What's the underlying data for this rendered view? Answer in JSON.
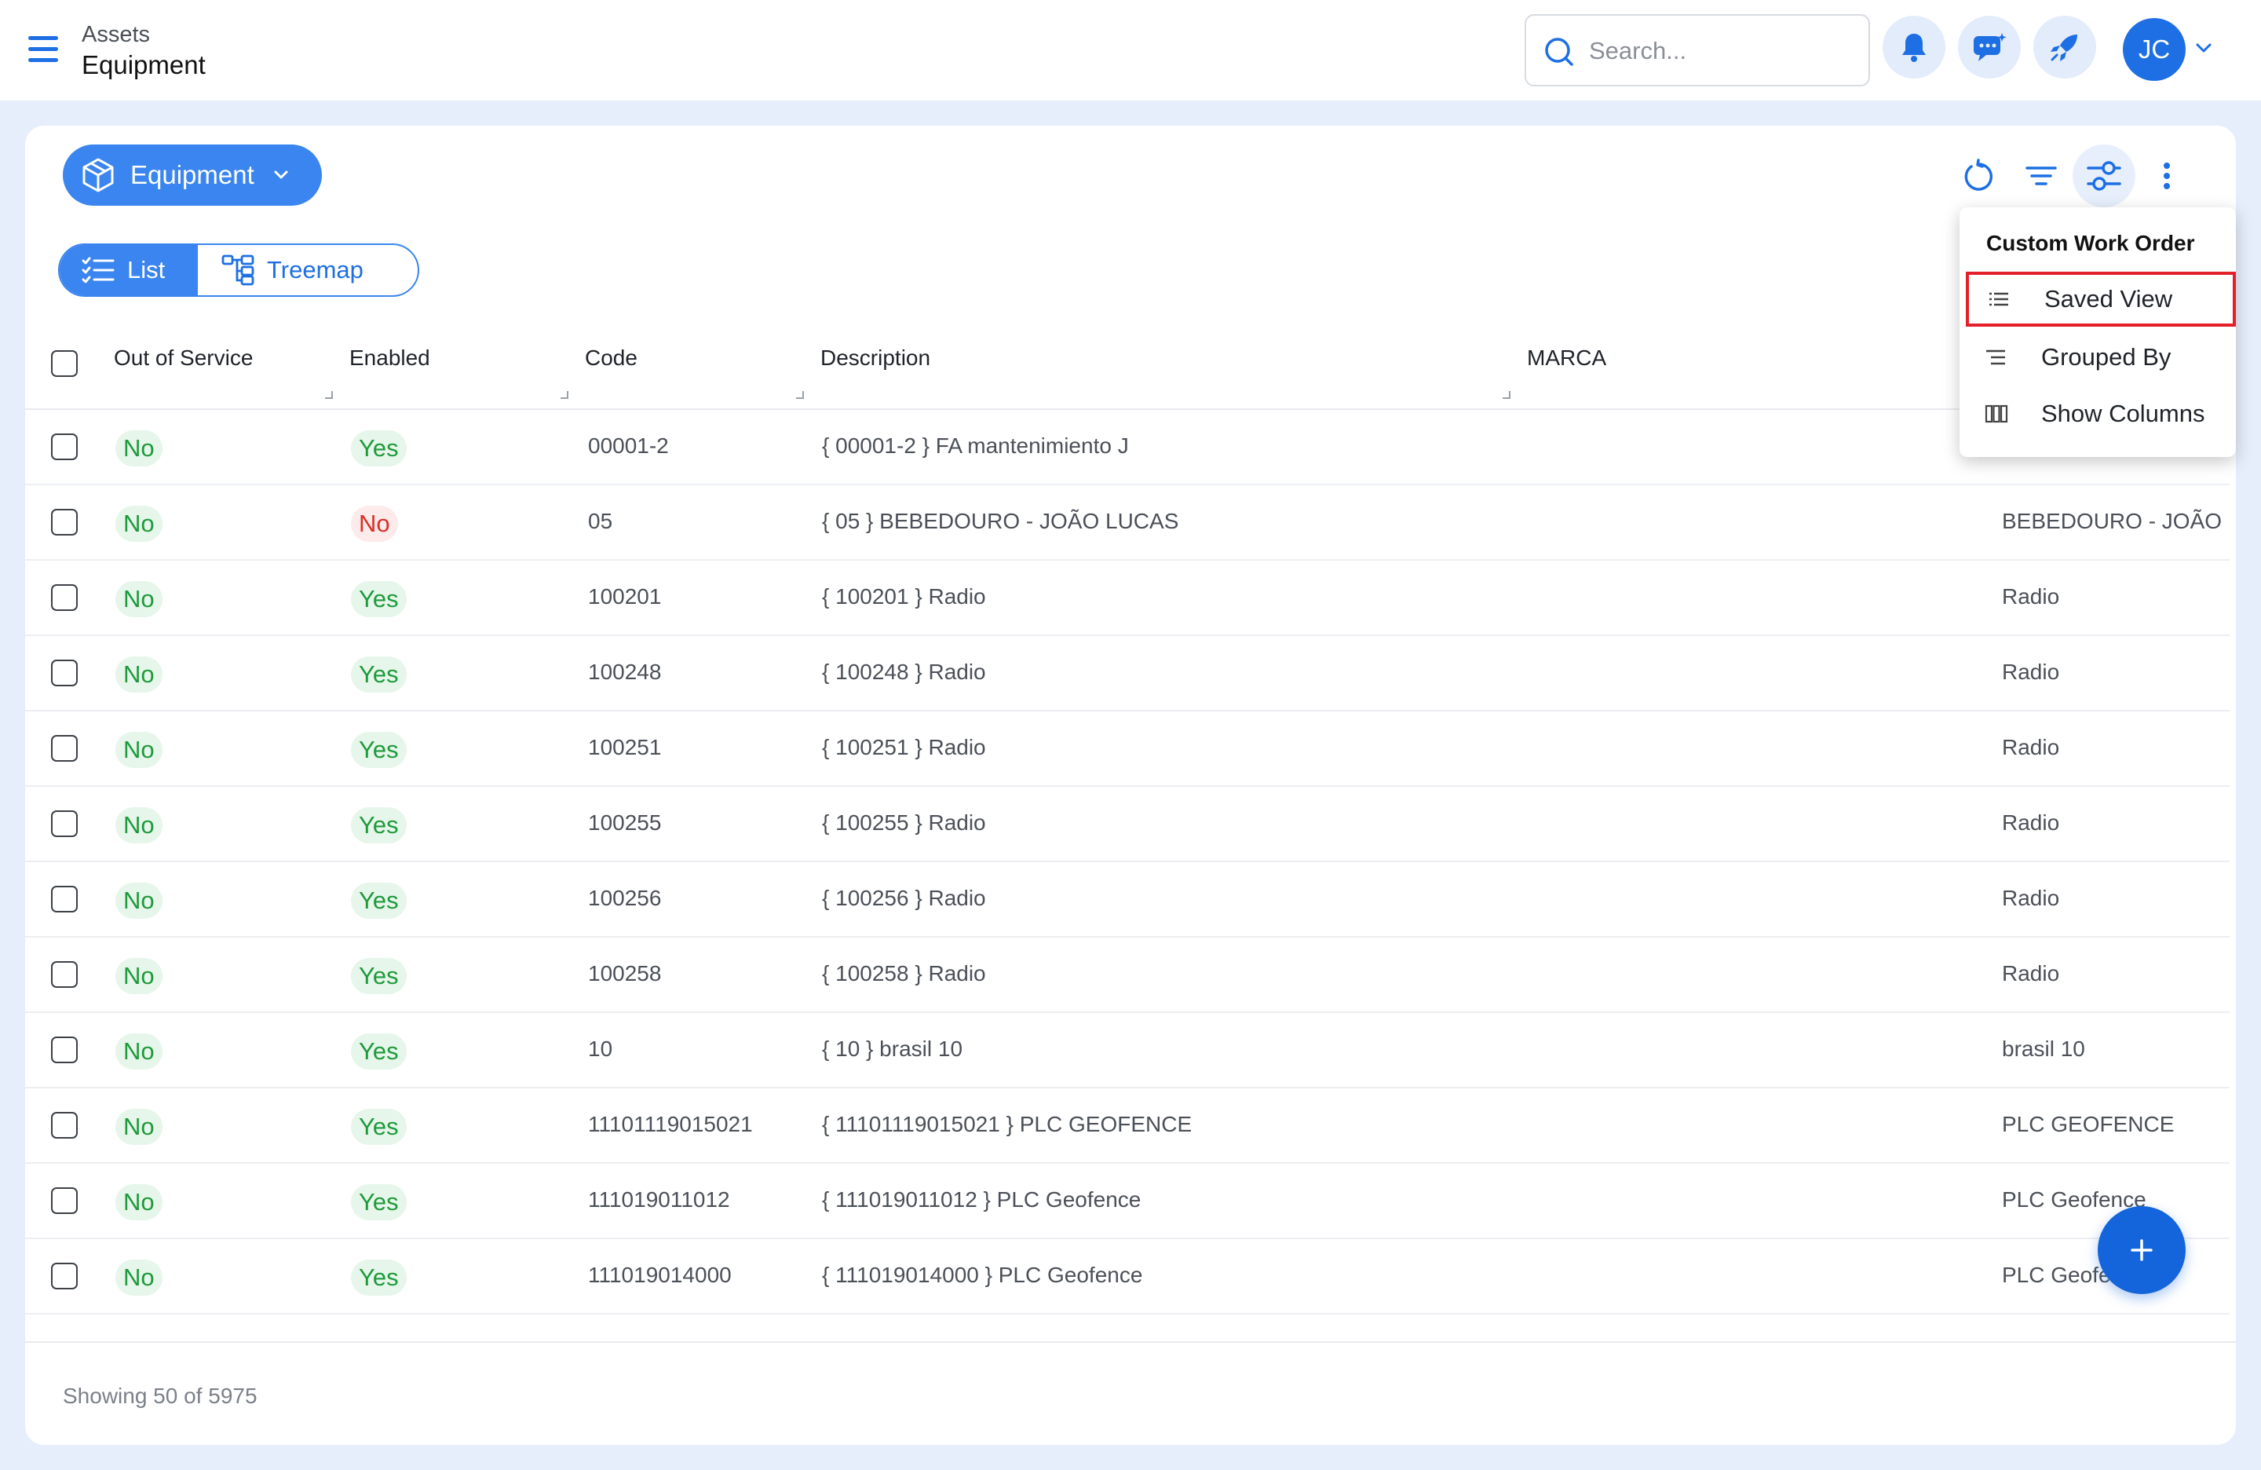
{
  "header": {
    "breadcrumb_parent": "Assets",
    "breadcrumb_current": "Equipment",
    "search_placeholder": "Search...",
    "avatar_initials": "JC"
  },
  "toolbar": {
    "module_label": "Equipment",
    "view_list_label": "List",
    "view_treemap_label": "Treemap",
    "active_view": "List"
  },
  "menu": {
    "title": "Custom Work Order",
    "items": [
      {
        "label": "Saved View",
        "icon": "list-lines-icon",
        "highlighted": true
      },
      {
        "label": "Grouped By",
        "icon": "grouped-lines-icon",
        "highlighted": false
      },
      {
        "label": "Show Columns",
        "icon": "columns-icon",
        "highlighted": false
      }
    ]
  },
  "table": {
    "columns": [
      "Out of Service",
      "Enabled",
      "Code",
      "Description",
      "MARCA"
    ],
    "rows": [
      {
        "out_of_service": "No",
        "enabled": "Yes",
        "code": "00001-2",
        "description": "{ 00001-2 } FA mantenimiento J",
        "marca": ""
      },
      {
        "out_of_service": "No",
        "enabled": "No",
        "code": "05",
        "description": "{ 05 } BEBEDOURO - JOÃO LUCAS",
        "marca": "BEBEDOURO - JOÃO LUCAS"
      },
      {
        "out_of_service": "No",
        "enabled": "Yes",
        "code": "100201",
        "description": "{ 100201 } Radio",
        "marca": "Radio"
      },
      {
        "out_of_service": "No",
        "enabled": "Yes",
        "code": "100248",
        "description": "{ 100248 } Radio",
        "marca": "Radio"
      },
      {
        "out_of_service": "No",
        "enabled": "Yes",
        "code": "100251",
        "description": "{ 100251 } Radio",
        "marca": "Radio"
      },
      {
        "out_of_service": "No",
        "enabled": "Yes",
        "code": "100255",
        "description": "{ 100255 } Radio",
        "marca": "Radio"
      },
      {
        "out_of_service": "No",
        "enabled": "Yes",
        "code": "100256",
        "description": "{ 100256 } Radio",
        "marca": "Radio"
      },
      {
        "out_of_service": "No",
        "enabled": "Yes",
        "code": "100258",
        "description": "{ 100258 } Radio",
        "marca": "Radio"
      },
      {
        "out_of_service": "No",
        "enabled": "Yes",
        "code": "10",
        "description": "{ 10 } brasil 10",
        "marca": "brasil 10"
      },
      {
        "out_of_service": "No",
        "enabled": "Yes",
        "code": "11101119015021",
        "description": "{ 11101119015021 } PLC GEOFENCE",
        "marca": "PLC GEOFENCE"
      },
      {
        "out_of_service": "No",
        "enabled": "Yes",
        "code": "111019011012",
        "description": "{ 111019011012 } PLC Geofence",
        "marca": "PLC Geofence"
      },
      {
        "out_of_service": "No",
        "enabled": "Yes",
        "code": "111019014000",
        "description": "{ 111019014000 } PLC Geofence",
        "marca": "PLC Geofence"
      }
    ]
  },
  "footer": {
    "count_text": "Showing 50 of 5975"
  },
  "colors": {
    "primary": "#3a85ef",
    "yes_green": "#1e9a3b",
    "no_red": "#d93025",
    "highlight_border": "#e3202a"
  }
}
